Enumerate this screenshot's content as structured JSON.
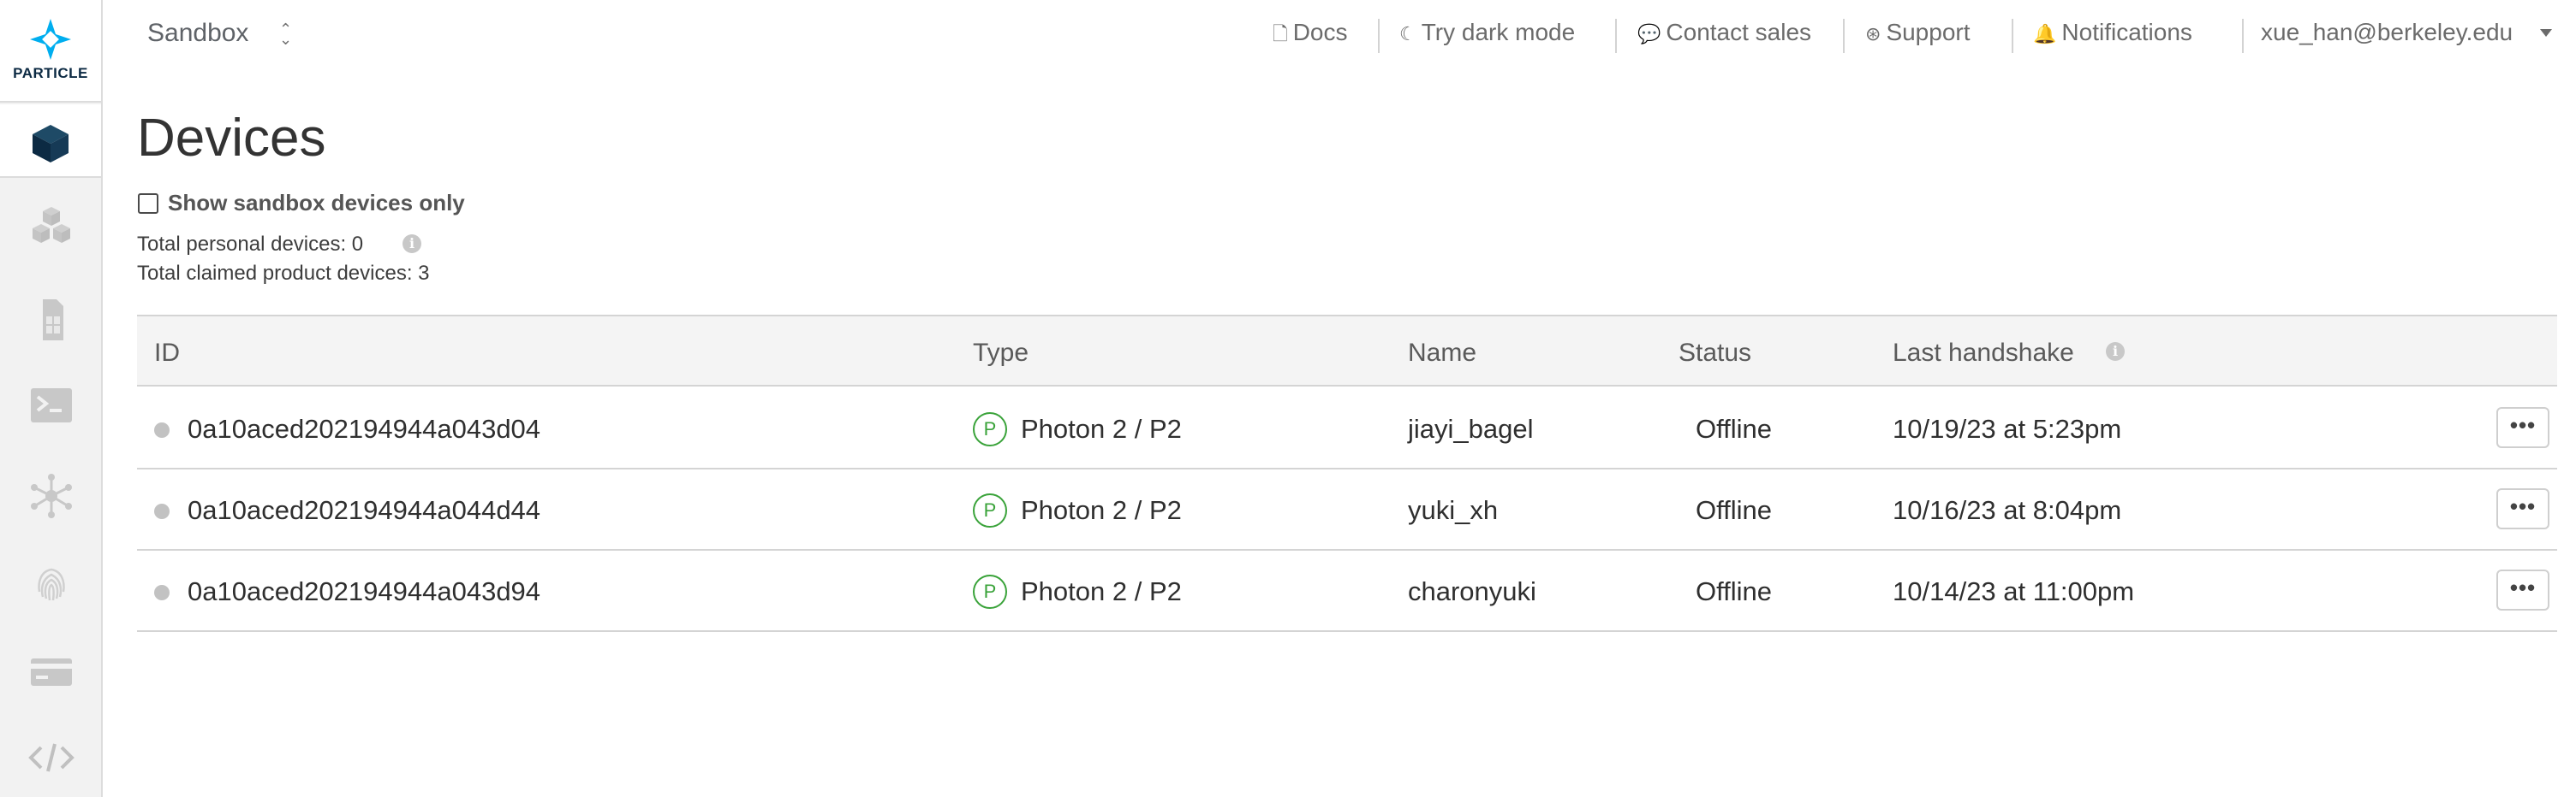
{
  "brand": {
    "logo_text": "PARTICLE"
  },
  "header": {
    "org_name": "Sandbox",
    "links": {
      "docs": "Docs",
      "dark_mode": "Try dark mode",
      "contact_sales": "Contact sales",
      "support": "Support",
      "notifications": "Notifications",
      "user_email": "xue_han@berkeley.edu"
    }
  },
  "sidebar": {
    "items": [
      {
        "icon": "cube-icon",
        "active": true
      },
      {
        "icon": "cubes-icon",
        "active": false
      },
      {
        "icon": "sim-card-icon",
        "active": false
      },
      {
        "icon": "terminal-icon",
        "active": false
      },
      {
        "icon": "network-icon",
        "active": false
      },
      {
        "icon": "fingerprint-icon",
        "active": false
      },
      {
        "icon": "credit-card-icon",
        "active": false
      },
      {
        "icon": "code-icon",
        "active": false
      }
    ]
  },
  "page": {
    "title": "Devices",
    "filter_label": "Show sandbox devices only",
    "filter_checked": false,
    "total_personal": "Total personal devices: 0",
    "total_claimed": "Total claimed product devices: 3"
  },
  "table": {
    "columns": [
      "ID",
      "Type",
      "Name",
      "Status",
      "Last handshake"
    ],
    "rows": [
      {
        "id": "0a10aced202194944a043d04",
        "type_badge": "P",
        "type": "Photon 2 / P2",
        "name": "jiayi_bagel",
        "status": "Offline",
        "last_handshake": "10/19/23 at 5:23pm",
        "actions": "•••"
      },
      {
        "id": "0a10aced202194944a044d44",
        "type_badge": "P",
        "type": "Photon 2 / P2",
        "name": "yuki_xh",
        "status": "Offline",
        "last_handshake": "10/16/23 at 8:04pm",
        "actions": "•••"
      },
      {
        "id": "0a10aced202194944a043d94",
        "type_badge": "P",
        "type": "Photon 2 / P2",
        "name": "charonyuki",
        "status": "Offline",
        "last_handshake": "10/14/23 at 11:00pm",
        "actions": "•••"
      }
    ]
  },
  "colors": {
    "accent": "#00aeef",
    "status_dot": "#c2c2c2",
    "type_badge": "#3aa33a",
    "sidebar_bg": "#f2f2f2"
  }
}
